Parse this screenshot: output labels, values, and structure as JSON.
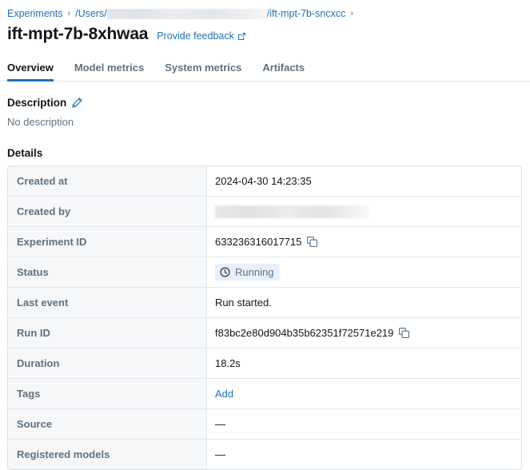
{
  "breadcrumb": {
    "root_label": "Experiments",
    "separator": "›",
    "path_prefix": "/Users/",
    "path_redacted": true,
    "path_suffix": "/ift-mpt-7b-sncxcc",
    "trailing_separator": "›"
  },
  "header": {
    "title": "ift-mpt-7b-8xhwaa",
    "feedback_label": "Provide feedback",
    "feedback_icon": "external-link-icon"
  },
  "tabs": [
    {
      "label": "Overview",
      "active": true
    },
    {
      "label": "Model metrics",
      "active": false
    },
    {
      "label": "System metrics",
      "active": false
    },
    {
      "label": "Artifacts",
      "active": false
    }
  ],
  "description": {
    "heading": "Description",
    "edit_icon": "pencil-icon",
    "body": "No description"
  },
  "details": {
    "heading": "Details",
    "rows": [
      {
        "label": "Created at",
        "value": "2024-04-30 14:23:35",
        "kind": "text"
      },
      {
        "label": "Created by",
        "value": "",
        "kind": "redacted"
      },
      {
        "label": "Experiment ID",
        "value": "633236316017715",
        "kind": "copyable",
        "copy_icon": "copy-icon"
      },
      {
        "label": "Status",
        "value": "Running",
        "kind": "badge",
        "badge_icon": "clock-icon"
      },
      {
        "label": "Last event",
        "value": "Run started.",
        "kind": "text"
      },
      {
        "label": "Run ID",
        "value": "f83bc2e80d904b35b62351f72571e219",
        "kind": "copyable",
        "copy_icon": "copy-icon"
      },
      {
        "label": "Duration",
        "value": "18.2s",
        "kind": "text"
      },
      {
        "label": "Tags",
        "value": "Add",
        "kind": "link"
      },
      {
        "label": "Source",
        "value": "—",
        "kind": "text"
      },
      {
        "label": "Registered models",
        "value": "—",
        "kind": "text"
      }
    ]
  },
  "colors": {
    "link": "#2272b4",
    "label_text": "#5f7281",
    "badge_bg": "#e8f1fb",
    "table_border": "#dce0e4",
    "label_cell_bg": "#f6f7f9"
  }
}
